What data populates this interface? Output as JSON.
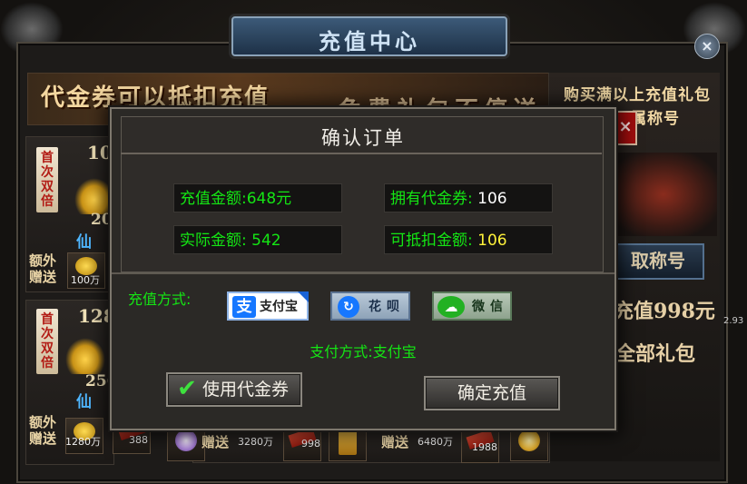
{
  "window": {
    "title": "充值中心",
    "close_icon": "close-icon"
  },
  "banner": {
    "text": "代金券可以抵扣充值",
    "text2": "免费礼包不停送"
  },
  "right_panel": {
    "title_line1": "购买满以上充值礼包",
    "title_line2": "属称号",
    "close_label": "×",
    "button_label": "取称号",
    "text1": "充值998元",
    "text2": "全部礼包",
    "side_number": "2.93"
  },
  "cards": [
    {
      "tag": "首次双倍",
      "amount_top": "10",
      "amount_bottom": "20",
      "badge": "仙",
      "extra_label": "额外赠送",
      "items": [
        {
          "qty": "100万"
        }
      ]
    },
    {
      "tag": "首次双倍",
      "amount_top": "128",
      "amount_bottom": "256",
      "badge": "仙",
      "extra_label": "额外赠送",
      "items": [
        {
          "qty": "1280万"
        },
        {
          "qty": "388"
        }
      ]
    }
  ],
  "bottom_row": [
    {
      "label": "赠送",
      "qty": "3280万"
    },
    {
      "qty": "998"
    },
    {
      "label": "赠送",
      "qty": "6480万"
    },
    {
      "qty": "1988"
    }
  ],
  "modal": {
    "title": "确认订单",
    "recharge_amount_label": "充值金额:",
    "recharge_amount_value": "648元",
    "actual_amount_label": "实际金额:",
    "actual_amount_value": "542",
    "own_voucher_label": "拥有代金券:",
    "own_voucher_value": "106",
    "deductible_label": "可抵扣金额:",
    "deductible_value": "106",
    "pay_method_label": "充值方式:",
    "pay_options": [
      {
        "logo": "支",
        "label": "支付宝"
      },
      {
        "logo": "↻",
        "label": "花呗"
      },
      {
        "logo": "☁",
        "label": "微信"
      }
    ],
    "current_pay": "支付方式:支付宝",
    "use_voucher_button": "使用代金券",
    "confirm_button": "确定充值"
  },
  "colors": {
    "field_green": "#14e614",
    "value_yellow": "#fff23a",
    "alipay_blue": "#1677ff",
    "wechat_green": "#22b122"
  }
}
